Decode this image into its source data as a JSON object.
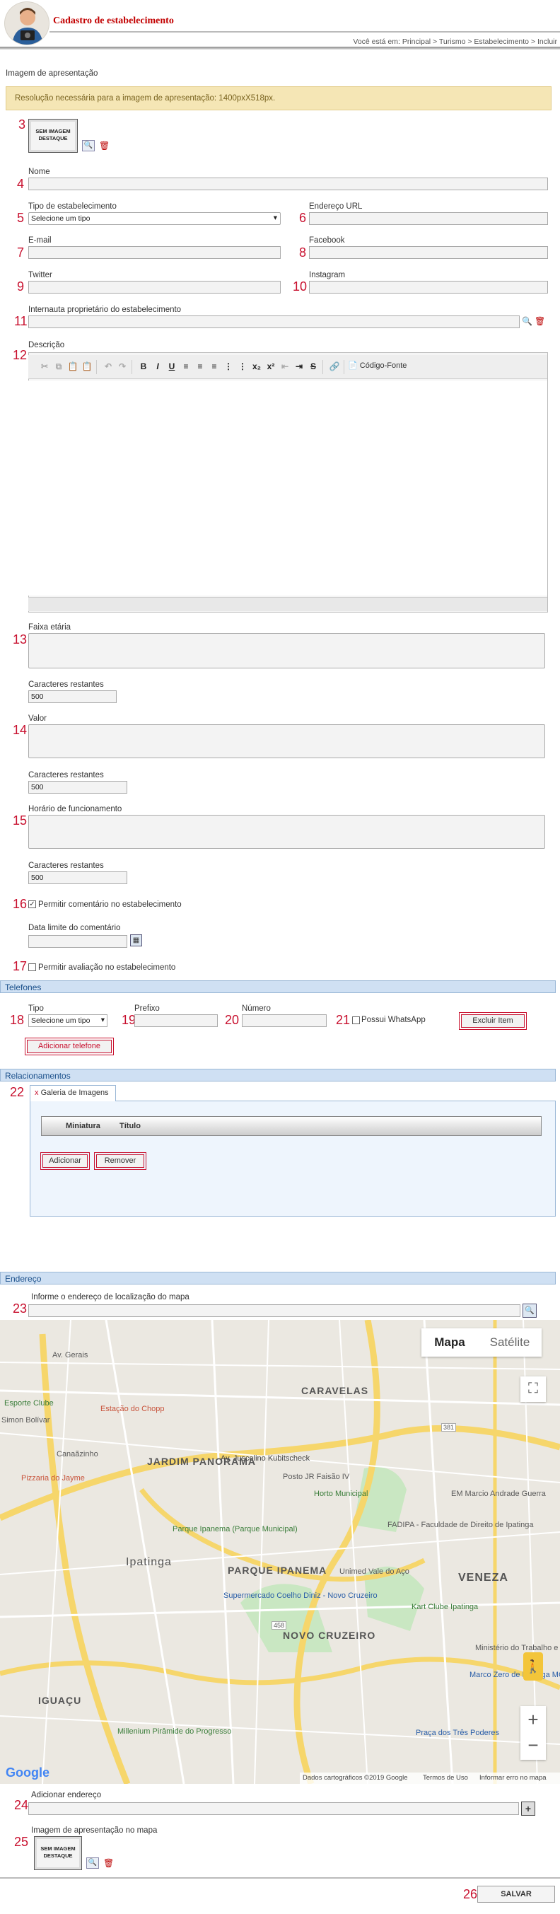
{
  "header": {
    "title": "Cadastro de estabelecimento",
    "breadcrumb": "Você está em: Principal > Turismo > Estabelecimento > Incluir"
  },
  "image_section": {
    "label": "Imagem de apresentação",
    "warning": "Resolução necessária para a imagem de apresentação: 1400pxX518px.",
    "placeholder": "SEM IMAGEM DESTAQUE"
  },
  "markers": [
    "3",
    "4",
    "5",
    "6",
    "7",
    "8",
    "9",
    "10",
    "11",
    "12",
    "13",
    "14",
    "15",
    "16",
    "17",
    "18",
    "19",
    "20",
    "21",
    "22",
    "23",
    "24",
    "25",
    "26"
  ],
  "fields": {
    "nome": "Nome",
    "tipo": "Tipo de estabelecimento",
    "tipo_value": "Selecione um tipo",
    "url": "Endereço URL",
    "email": "E-mail",
    "facebook": "Facebook",
    "twitter": "Twitter",
    "instagram": "Instagram",
    "owner": "Internauta proprietário do estabelecimento",
    "descricao": "Descrição",
    "faixa": "Faixa etária",
    "caracteres": "Caracteres restantes",
    "caracteres_value": "500",
    "valor": "Valor",
    "horario": "Horário de funcionamento",
    "permitir_comentario": "Permitir comentário no estabelecimento",
    "data_limite": "Data limite do comentário",
    "permitir_avaliacao": "Permitir avaliação no estabelecimento"
  },
  "editor": {
    "source_label": "Código-Fonte"
  },
  "telefones": {
    "title": "Telefones",
    "tipo": "Tipo",
    "tipo_value": "Selecione um tipo",
    "prefixo": "Prefixo",
    "numero": "Número",
    "whatsapp": "Possui WhatsApp",
    "excluir": "Excluir Item",
    "adicionar": "Adicionar telefone"
  },
  "relacionamentos": {
    "title": "Relacionamentos",
    "tab": "Galeria de Imagens",
    "col_miniatura": "Miniatura",
    "col_titulo": "Título",
    "adicionar": "Adicionar",
    "remover": "Remover"
  },
  "endereco": {
    "title": "Endereço",
    "informe": "Informe o endereço de localização do mapa",
    "adicionar": "Adicionar endereço",
    "imagem_mapa": "Imagem de apresentação no mapa"
  },
  "map": {
    "tab_mapa": "Mapa",
    "tab_satelite": "Satélite",
    "footer": [
      "Dados cartográficos ©2019 Google",
      "Termos de Uso",
      "Informar erro no mapa"
    ],
    "google": "Google",
    "labels": [
      "Av. Gerais",
      "Estação do Chopp",
      "Esporte Clube",
      "Simon Bolívar",
      "CARAVELAS",
      "Canaãzinho",
      "JARDIM PANORAMA",
      "Av. Juscelino Kubitscheck",
      "Pizzaria do Jayme",
      "Posto JR Faisão IV",
      "Horto Municipal",
      "EM Marcio Andrade Guerra",
      "Parque Ipanema (Parque Municipal)",
      "FADIPA - Faculdade de Direito de Ipatinga",
      "Ipatinga",
      "PARQUE IPANEMA",
      "Unimed Vale do Aço",
      "VENEZA",
      "Supermercado Coelho Diniz - Novo Cruzeiro",
      "Kart Clube Ipatinga",
      "NOVO CRUZEIRO",
      "Ministério do Trabalho e Emprego - MTE",
      "Marco Zero de Ipatinga MG",
      "IGUAÇU",
      "Millenium Pirâmide do Progresso",
      "Praça dos Três Poderes",
      "381",
      "458"
    ]
  },
  "save": "SALVAR"
}
